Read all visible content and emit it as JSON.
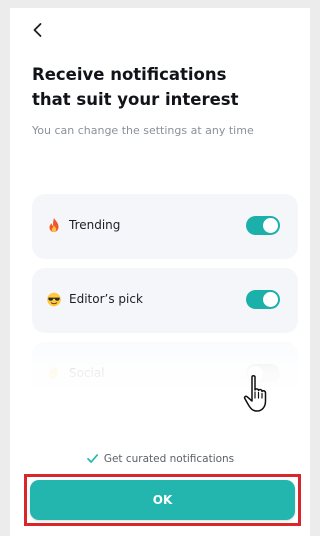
{
  "header": {
    "back_icon": "chevron-left-icon",
    "title_line1": "Receive notifications",
    "title_line2": "that suit your interest",
    "subtitle": "You can change the settings at any time"
  },
  "settings": [
    {
      "label": "Trending",
      "icon": "fire-emoji-icon",
      "enabled": true
    },
    {
      "label": "Editor’s pick",
      "icon": "sunglasses-face-emoji-icon",
      "enabled": true
    },
    {
      "label": "Social",
      "icon": "waving-hand-emoji-icon",
      "enabled": false
    }
  ],
  "footer": {
    "curated_text": "Get curated notifications",
    "curated_icon": "checkmark-icon",
    "ok_label": "OK"
  },
  "colors": {
    "accent": "#22b6ae",
    "toggle_on": "#1bb0aa",
    "toggle_off": "#c5c8ce",
    "highlight_border": "#d8262b"
  }
}
